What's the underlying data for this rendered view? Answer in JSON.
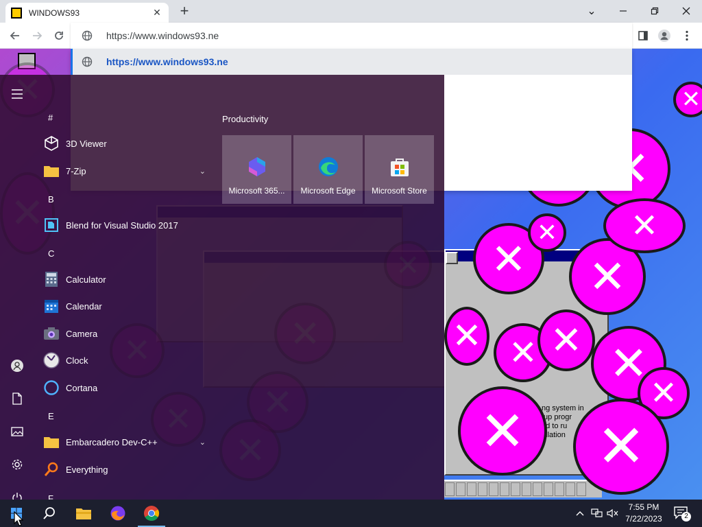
{
  "browser": {
    "tab_title": "WINDOWS93",
    "new_tab": "+",
    "address": "https://www.windows93.ne",
    "suggestions": [
      {
        "text": "https://www.windows93.ne",
        "selected": true
      }
    ]
  },
  "start_menu": {
    "groups": [
      {
        "letter": "#",
        "items": [
          {
            "label": "3D Viewer",
            "icon": "cube-icon"
          },
          {
            "label": "7-Zip",
            "icon": "folder-icon",
            "expandable": true
          }
        ]
      },
      {
        "letter": "B",
        "items": [
          {
            "label": "Blend for Visual Studio 2017",
            "icon": "blend-icon"
          }
        ]
      },
      {
        "letter": "C",
        "items": [
          {
            "label": "Calculator",
            "icon": "calculator-icon"
          },
          {
            "label": "Calendar",
            "icon": "calendar-icon"
          },
          {
            "label": "Camera",
            "icon": "camera-icon"
          },
          {
            "label": "Clock",
            "icon": "clock-icon"
          },
          {
            "label": "Cortana",
            "icon": "cortana-icon"
          }
        ]
      },
      {
        "letter": "E",
        "items": [
          {
            "label": "Embarcadero Dev-C++",
            "icon": "folder-icon",
            "expandable": true
          },
          {
            "label": "Everything",
            "icon": "search-icon"
          }
        ]
      },
      {
        "letter": "F",
        "items": []
      }
    ],
    "tiles_group_title": "Productivity",
    "tiles": [
      {
        "label": "Microsoft 365...",
        "icon": "m365-icon"
      },
      {
        "label": "Microsoft Edge",
        "icon": "edge-icon"
      },
      {
        "label": "Microsoft Store",
        "icon": "store-icon"
      }
    ]
  },
  "page": {
    "setup_text": "ng system in\ntup progr\ned to ru\nallation"
  },
  "taskbar": {
    "time": "7:55 PM",
    "date": "7/22/2023",
    "notifications": "2",
    "accent": "#76b9ed"
  },
  "theme": {
    "bubble_color": "#ff00ff",
    "start_menu_bg": "#2e0a2e"
  }
}
